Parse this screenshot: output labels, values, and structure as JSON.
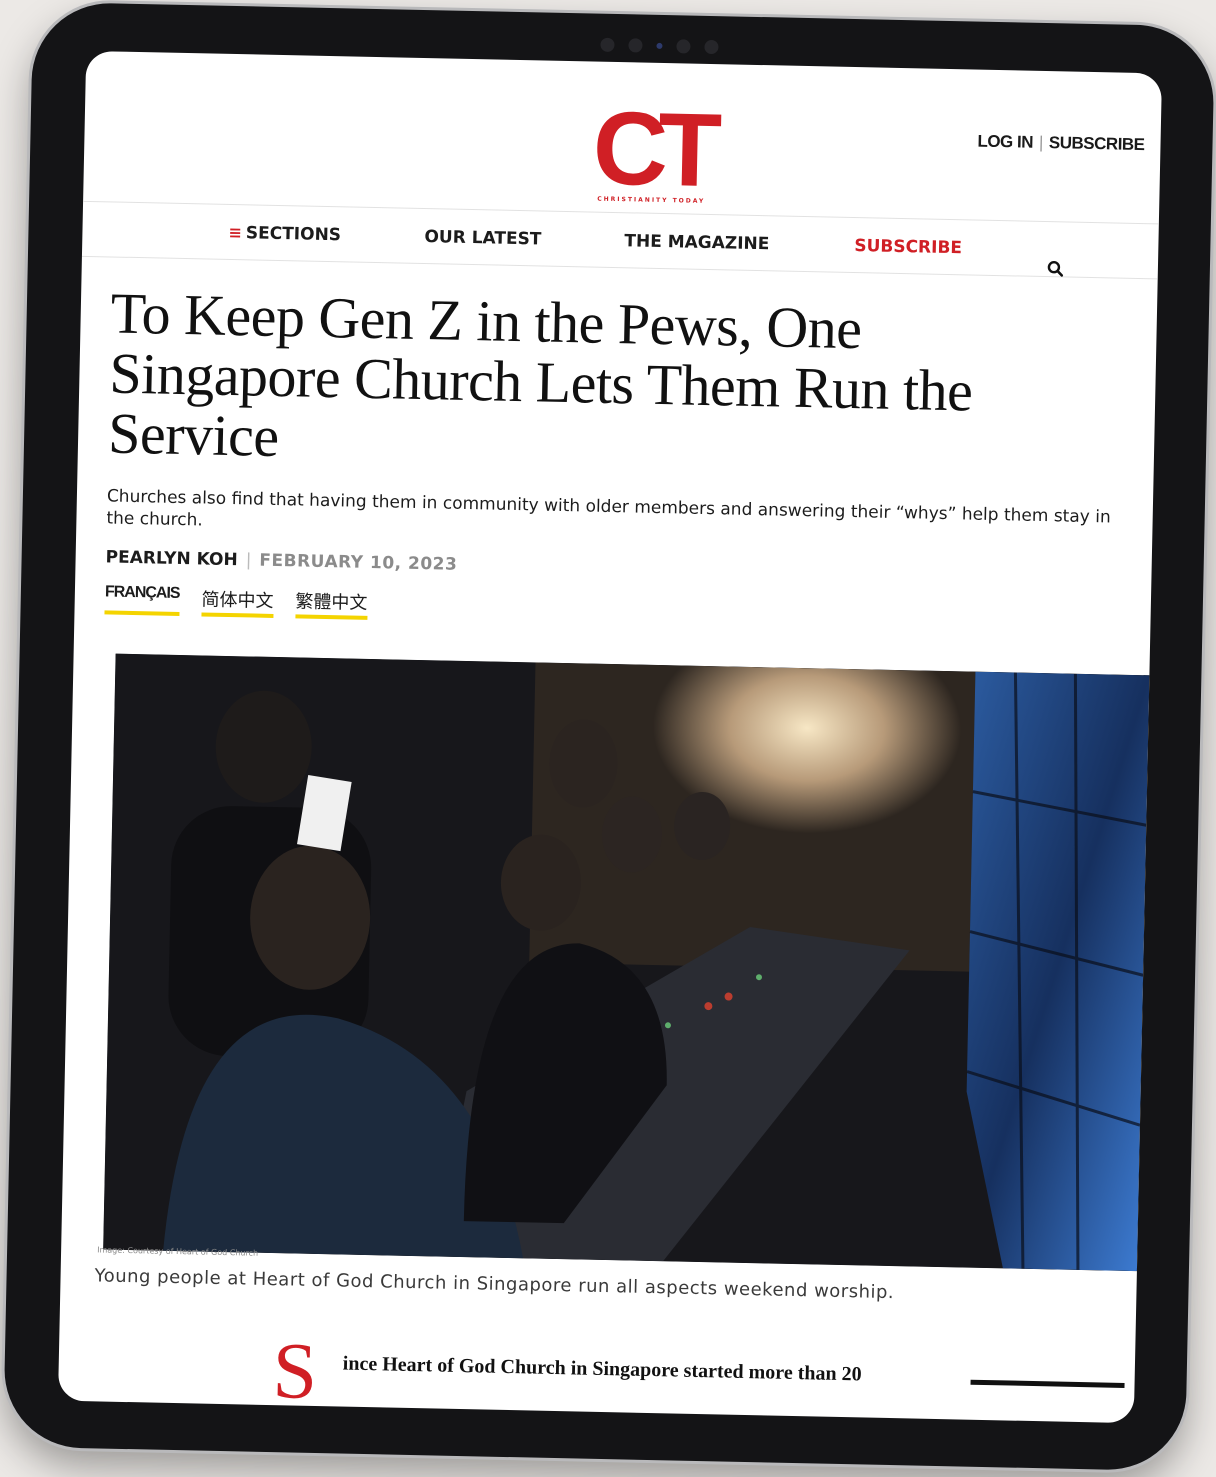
{
  "header": {
    "logo_text": "CT",
    "logo_subtitle": "CHRISTIANITY TODAY",
    "login_label": "LOG IN",
    "subscribe_label": "SUBSCRIBE"
  },
  "nav": {
    "sections_label": "SECTIONS",
    "latest_label": "OUR LATEST",
    "magazine_label": "THE MAGAZINE",
    "subscribe_label": "SUBSCRIBE"
  },
  "article": {
    "headline": "To Keep Gen Z in the Pews, One Singapore Church Lets Them Run the Service",
    "dek": "Churches also find that having them in community with older members and answering their “whys” help them stay in the church.",
    "author": "PEARLYN KOH",
    "date": "FEBRUARY 10, 2023",
    "translations": [
      "FRANÇAIS",
      "简体中文",
      "繁體中文"
    ],
    "image_credit": "Image: Courtesy of Heart of God Church",
    "caption": "Young people at Heart of God Church in Singapore run all aspects weekend worship.",
    "dropcap": "S",
    "body_first_line": "ince Heart of God Church in Singapore started more than 20"
  },
  "colors": {
    "brand_red": "#d01f25",
    "underline_yellow": "#f4d400"
  },
  "icons": {
    "menu": "menu-icon",
    "search": "search-icon"
  }
}
